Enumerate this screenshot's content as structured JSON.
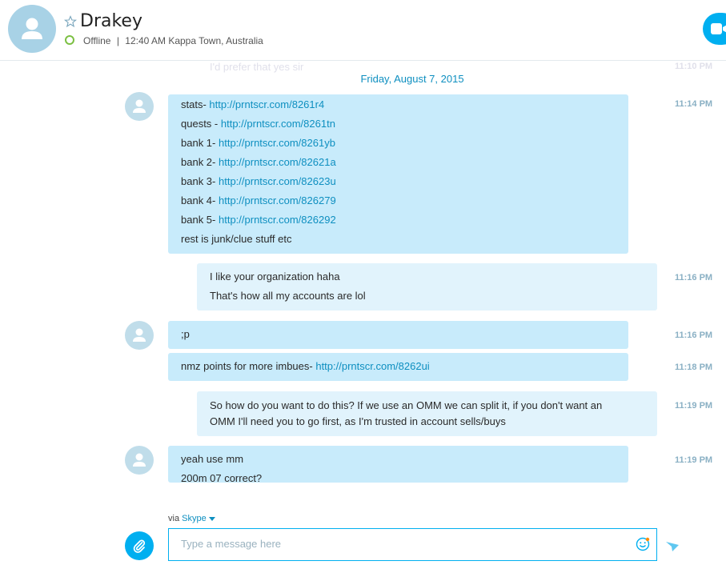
{
  "header": {
    "contact_name": "Drakey",
    "status_text": "Offline",
    "separator": "|",
    "local_time": "12:40 AM Kappa Town, Australia",
    "icons": [
      "avatar-icon",
      "star-icon",
      "status-offline-icon",
      "video-call-icon"
    ],
    "colors": {
      "accent": "#00aff0",
      "status_ring": "#7cc043"
    }
  },
  "conversation": {
    "faded_previous": {
      "text": "I'd prefer that yes sir",
      "time": "11:10 PM"
    },
    "date_separator": "Friday, August 7, 2015",
    "messages": [
      {
        "direction": "incoming",
        "time": "11:14 PM",
        "lines": [
          {
            "text": "stats- ",
            "link": "http://prntscr.com/8261r4"
          },
          {
            "text": "quests - ",
            "link": "http://prntscr.com/8261tn"
          },
          {
            "text": "bank 1- ",
            "link": "http://prntscr.com/8261yb"
          },
          {
            "text": "bank 2- ",
            "link": "http://prntscr.com/82621a"
          },
          {
            "text": "bank 3- ",
            "link": "http://prntscr.com/82623u"
          },
          {
            "text": "bank 4- ",
            "link": "http://prntscr.com/826279"
          },
          {
            "text": "bank 5- ",
            "link": "http://prntscr.com/826292"
          },
          {
            "text": "rest is junk/clue stuff etc",
            "link": ""
          }
        ]
      },
      {
        "direction": "outgoing",
        "time": "11:16 PM",
        "lines": [
          {
            "text": "I like your organization haha",
            "link": ""
          },
          {
            "text": "That's how all my accounts are lol",
            "link": ""
          }
        ]
      },
      {
        "direction": "incoming",
        "time": "11:16 PM",
        "lines": [
          {
            "text": ";p",
            "link": ""
          }
        ]
      },
      {
        "direction": "incoming",
        "time": "11:18 PM",
        "lines": [
          {
            "text": "nmz points for more imbues- ",
            "link": "http://prntscr.com/8262ui"
          }
        ]
      },
      {
        "direction": "outgoing",
        "time": "11:19 PM",
        "lines": [
          {
            "text": "So how do you want to do this? If we use an OMM we can split it, if you don't want an",
            "link": ""
          },
          {
            "text": "OMM I'll need you to go first, as I'm trusted in account sells/buys",
            "link": ""
          }
        ]
      },
      {
        "direction": "incoming",
        "time": "11:19 PM",
        "lines": [
          {
            "text": "yeah use mm",
            "link": ""
          },
          {
            "text": "200m 07 correct?",
            "link": ""
          }
        ]
      }
    ]
  },
  "composer": {
    "via_label": "via",
    "via_service": "Skype",
    "placeholder": "Type a message here",
    "icons": [
      "attach-icon",
      "emoji-icon",
      "send-icon",
      "chevron-down-icon"
    ]
  }
}
